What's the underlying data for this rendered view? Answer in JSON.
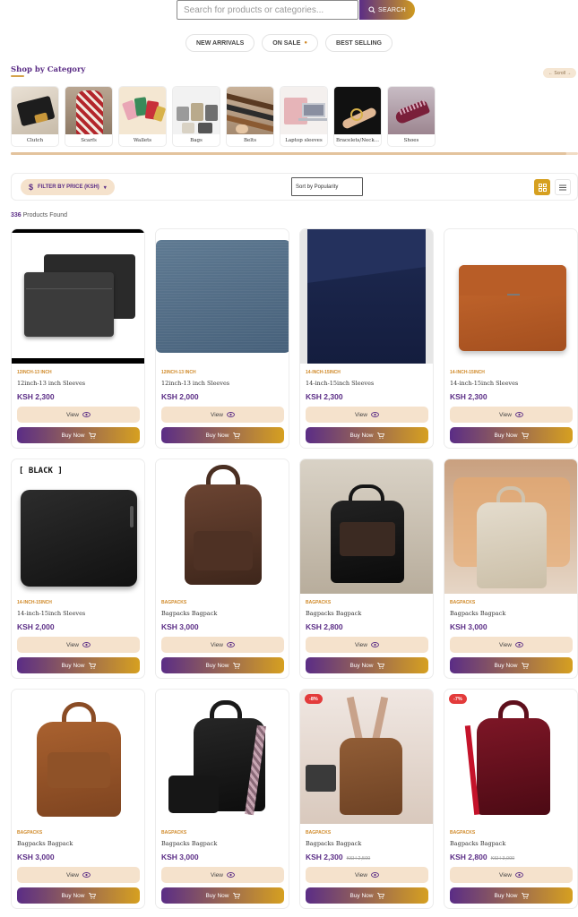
{
  "search": {
    "placeholder": "Search for products or categories...",
    "button_label": "SEARCH"
  },
  "pills": [
    {
      "label": "NEW ARRIVALS"
    },
    {
      "label": "ON SALE",
      "marker": "●"
    },
    {
      "label": "BEST SELLING"
    }
  ],
  "categories": {
    "title": "Shop by Category",
    "scroll_hint": "← Scroll →",
    "items": [
      {
        "label": "Clutch"
      },
      {
        "label": "Scarfs"
      },
      {
        "label": "Wallets"
      },
      {
        "label": "Bags"
      },
      {
        "label": "Belts"
      },
      {
        "label": "Laptop sleeves"
      },
      {
        "label": "Bracelets/Neck..."
      },
      {
        "label": "Shoes"
      }
    ]
  },
  "toolbar": {
    "price_filter_label": "FILTER BY PRICE (KSH)",
    "price_filter_icon": "$",
    "price_filter_caret": "▾",
    "sort_value": "Sort by Popularity"
  },
  "results": {
    "count": "336",
    "suffix": "Products Found"
  },
  "buttons": {
    "view_label": "View",
    "buy_label": "Buy Now"
  },
  "products": [
    {
      "category": "12INCH-13 INCH",
      "title": "12inch-13 inch Sleeves",
      "price": "KSH 2,300",
      "old_price": "",
      "discount": ""
    },
    {
      "category": "12INCH-13 INCH",
      "title": "12inch-13 inch Sleeves",
      "price": "KSH 2,000",
      "old_price": "",
      "discount": ""
    },
    {
      "category": "14-INCH-15INCH",
      "title": "14-inch-15inch Sleeves",
      "price": "KSH 2,300",
      "old_price": "",
      "discount": ""
    },
    {
      "category": "14-INCH-15INCH",
      "title": "14-inch-15inch Sleeves",
      "price": "KSH 2,300",
      "old_price": "",
      "discount": ""
    },
    {
      "category": "14-INCH-15INCH",
      "title": "14-inch-15inch Sleeves",
      "price": "KSH 2,000",
      "old_price": "",
      "discount": "",
      "image_text": "[ BLACK ]"
    },
    {
      "category": "BAGPACKS",
      "title": "Bagpacks Bagpack",
      "price": "KSH 3,000",
      "old_price": "",
      "discount": ""
    },
    {
      "category": "BAGPACKS",
      "title": "Bagpacks Bagpack",
      "price": "KSH 2,800",
      "old_price": "",
      "discount": ""
    },
    {
      "category": "BAGPACKS",
      "title": "Bagpacks Bagpack",
      "price": "KSH 3,000",
      "old_price": "",
      "discount": ""
    },
    {
      "category": "BAGPACKS",
      "title": "Bagpacks Bagpack",
      "price": "KSH 3,000",
      "old_price": "",
      "discount": ""
    },
    {
      "category": "BAGPACKS",
      "title": "Bagpacks Bagpack",
      "price": "KSH 3,000",
      "old_price": "",
      "discount": ""
    },
    {
      "category": "BAGPACKS",
      "title": "Bagpacks Bagpack",
      "price": "KSH 2,300",
      "old_price": "KSH 2,500",
      "discount": "-8%"
    },
    {
      "category": "BAGPACKS",
      "title": "Bagpacks Bagpack",
      "price": "KSH 2,800",
      "old_price": "KSH 3,000",
      "discount": "-7%"
    }
  ],
  "colors": {
    "brand_purple": "#5b2d86",
    "brand_gold": "#d6a020",
    "beige": "#f5e2cc",
    "sale_red": "#e33b3b"
  }
}
